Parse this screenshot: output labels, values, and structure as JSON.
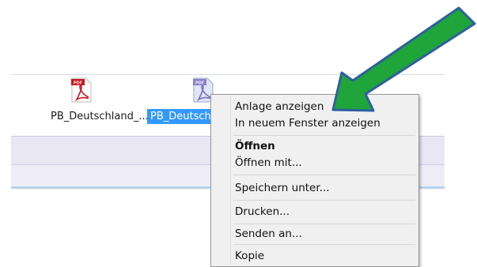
{
  "attachments": [
    {
      "name": "PB_Deutschland_...",
      "icon": "pdf-icon",
      "selected": false
    },
    {
      "name": "PB_Deutsch",
      "icon": "pdf-icon",
      "selected": true
    }
  ],
  "context_menu": {
    "groups": [
      [
        "Anlage anzeigen",
        "In neuem Fenster anzeigen"
      ],
      [
        "Öffnen",
        "Öffnen mit..."
      ],
      [
        "Speichern unter..."
      ],
      [
        "Drucken..."
      ],
      [
        "Senden an..."
      ],
      [
        "Kopie"
      ]
    ],
    "bold_item": "Öffnen"
  },
  "annotation": {
    "arrow_color": "#1fa53a",
    "arrow_outline": "#2f5f9e"
  },
  "colors": {
    "selection": "#3399ff",
    "band1": "#e8e7f3",
    "band2": "#eeedf7",
    "band_line": "#b7d3ea"
  }
}
